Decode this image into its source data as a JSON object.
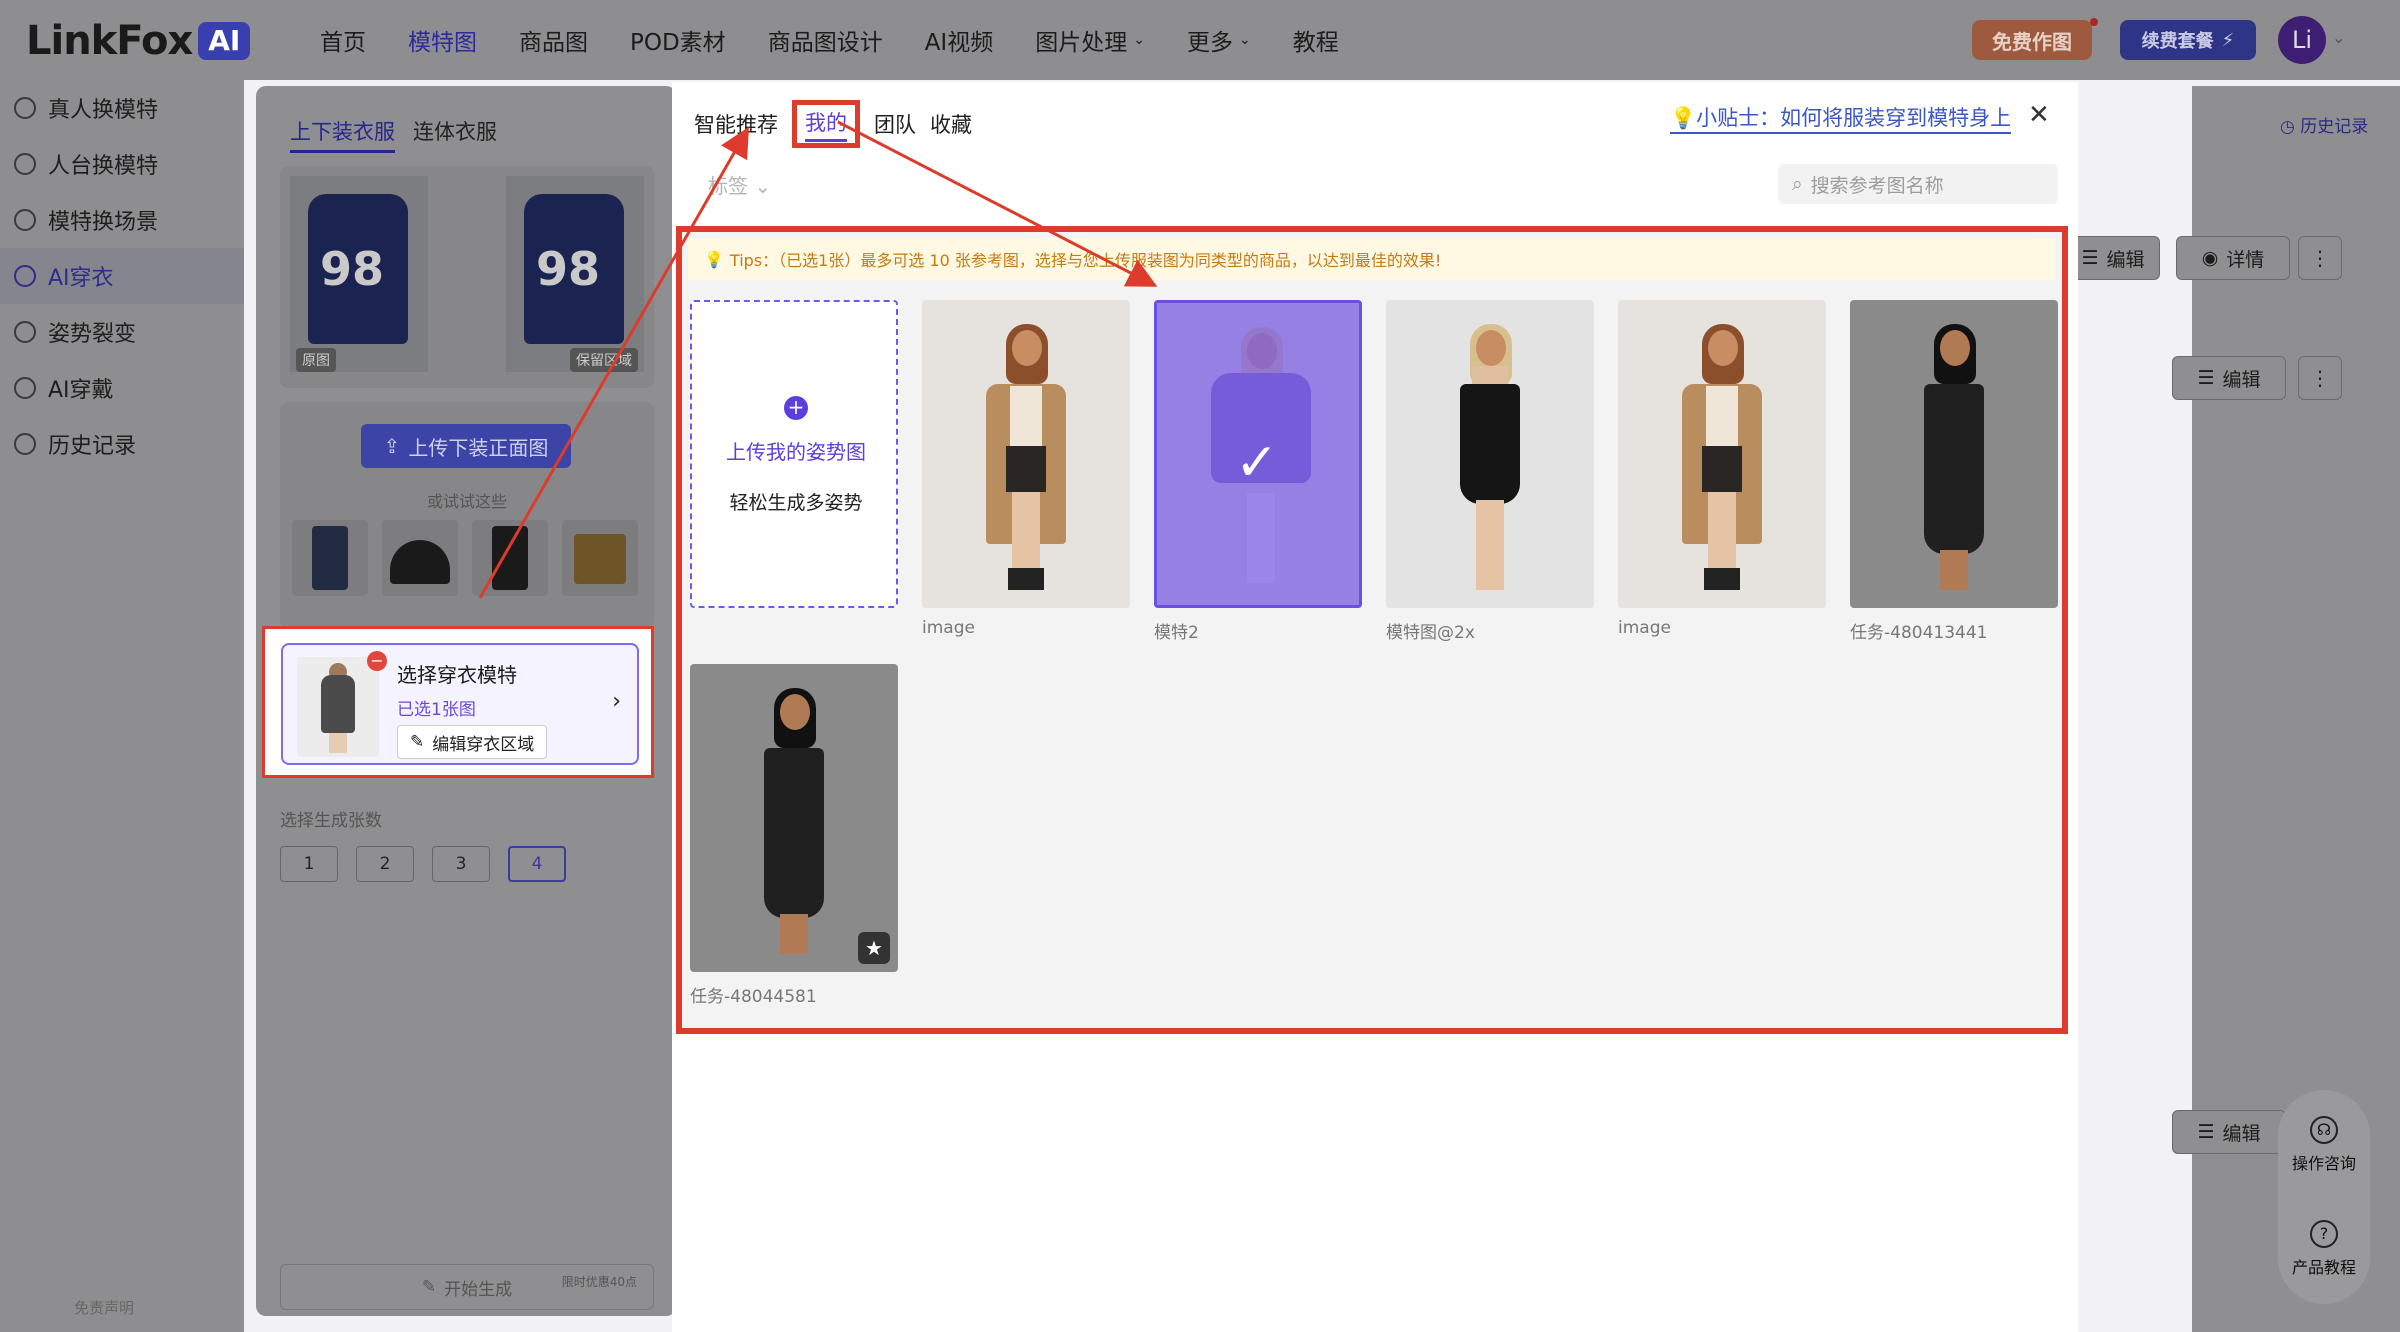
{
  "header": {
    "logo_text": "LinkFox",
    "logo_badge": "AI",
    "nav": [
      {
        "label": "首页",
        "active": false,
        "dropdown": false
      },
      {
        "label": "模特图",
        "active": true,
        "dropdown": false
      },
      {
        "label": "商品图",
        "active": false,
        "dropdown": false
      },
      {
        "label": "POD素材",
        "active": false,
        "dropdown": false
      },
      {
        "label": "商品图设计",
        "active": false,
        "dropdown": false
      },
      {
        "label": "AI视频",
        "active": false,
        "dropdown": false
      },
      {
        "label": "图片处理",
        "active": false,
        "dropdown": true
      },
      {
        "label": "更多",
        "active": false,
        "dropdown": true
      },
      {
        "label": "教程",
        "active": false,
        "dropdown": false
      }
    ],
    "free_btn": "免费作图",
    "renew_btn": "续费套餐",
    "avatar_text": "Li"
  },
  "sidebar": {
    "items": [
      {
        "label": "真人换模特",
        "icon": "person-swap-icon"
      },
      {
        "label": "人台换模特",
        "icon": "mannequin-icon"
      },
      {
        "label": "模特换场景",
        "icon": "scene-icon"
      },
      {
        "label": "AI穿衣",
        "icon": "shirt-icon"
      },
      {
        "label": "姿势裂变",
        "icon": "pose-icon"
      },
      {
        "label": "AI穿戴",
        "icon": "accessory-icon"
      },
      {
        "label": "历史记录",
        "icon": "history-icon"
      }
    ],
    "active_index": 3,
    "footer": "免责声明"
  },
  "panel": {
    "tabs": [
      "上下装衣服",
      "连体衣服"
    ],
    "original_tag": "原图",
    "keep_tag": "保留区域",
    "upload_btn": "上传下装正面图",
    "try_label": "或试试这些",
    "model_title": "选择穿衣模特",
    "model_selected": "已选1张图",
    "model_edit": "编辑穿衣区域",
    "count_label": "选择生成张数",
    "counts": [
      "1",
      "2",
      "3",
      "4"
    ],
    "count_active": "4",
    "gen_btn": "开始生成",
    "gen_note": "限时优惠40点"
  },
  "right": {
    "history": "历史记录",
    "edit": "编辑",
    "detail": "详情",
    "consult": "操作咨询",
    "tutorial": "产品教程"
  },
  "modal": {
    "tabs": [
      "智能推荐",
      "我的",
      "团队",
      "收藏"
    ],
    "active_tab": "我的",
    "tip_link": "💡小贴士：如何将服装穿到模特身上",
    "tag_filter": "标签",
    "search_placeholder": "搜索参考图名称",
    "tips": "Tips：（已选1张）最多可选 10 张参考图，选择与您上传服装图为同类型的商品，以达到最佳的效果!",
    "upload_title": "上传我的姿势图",
    "upload_sub": "轻松生成多姿势",
    "cards": [
      {
        "label": "image"
      },
      {
        "label": "模特2"
      },
      {
        "label": "模特图@2x"
      },
      {
        "label": "image"
      },
      {
        "label": "任务-480413441"
      },
      {
        "label": "任务-48044581"
      }
    ]
  },
  "colors": {
    "accent": "#5b3fdc",
    "annotation": "#dd3b2b"
  }
}
